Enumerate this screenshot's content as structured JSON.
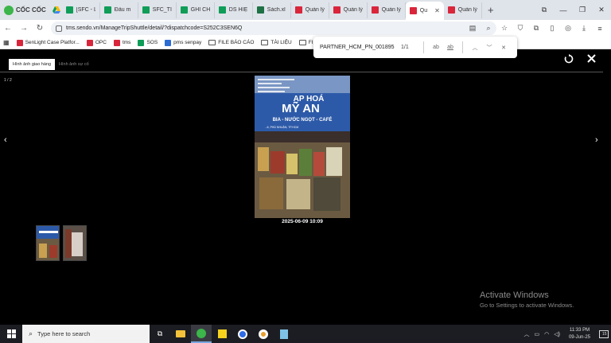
{
  "browser": {
    "brand": "CỐC CỐC",
    "tabs": [
      {
        "label": "[SFC - L",
        "color": "#0f9d58"
      },
      {
        "label": "Đầu m",
        "color": "#0f9d58"
      },
      {
        "label": "SFC_TI",
        "color": "#0f9d58"
      },
      {
        "label": "GHI CH",
        "color": "#0f9d58"
      },
      {
        "label": "DS HIỆ",
        "color": "#0f9d58"
      },
      {
        "label": "Sách.xl",
        "color": "#1e7145"
      },
      {
        "label": "Quản lý",
        "color": "#d9263b"
      },
      {
        "label": "Quản lý",
        "color": "#d9263b"
      },
      {
        "label": "Quản lý",
        "color": "#d9263b"
      },
      {
        "label": "Qu",
        "color": "#d9263b"
      },
      {
        "label": "Quản lý",
        "color": "#d9263b"
      }
    ],
    "url": "tms.sendo.vn/ManageTripShuttle/detail/?dispatchcode=S252C3SEN6Q",
    "bookmarks": [
      {
        "label": "SenLight Case Platfor...",
        "icon": "sendo-icon",
        "color": "#d9263b"
      },
      {
        "label": "OPC",
        "icon": "sendo-icon",
        "color": "#d9263b"
      },
      {
        "label": "tms",
        "icon": "sendo-icon",
        "color": "#d9263b"
      },
      {
        "label": "SOS",
        "icon": "sos-icon",
        "color": "#0f9d58"
      },
      {
        "label": "pms senpay",
        "icon": "senpay-icon",
        "color": "#2b6cd4"
      },
      {
        "label": "FILE BÁO CÁO",
        "icon": "folder-icon",
        "color": ""
      },
      {
        "label": "TÀI LIỆU",
        "icon": "folder-icon",
        "color": ""
      },
      {
        "label": "FILE C",
        "icon": "folder-icon",
        "color": ""
      }
    ]
  },
  "findbar": {
    "query": "PARTNER_HCM_PN_001895",
    "count": "1/1",
    "match_case_label": "ab",
    "whole_word_label": "ab"
  },
  "viewer": {
    "tabs": [
      {
        "label": "Hình ảnh giao hàng",
        "active": true
      },
      {
        "label": "Hình ảnh sự cố",
        "active": false
      }
    ],
    "counter": "1 / 2",
    "photo": {
      "timestamp": "2025-06-09 10:09",
      "store_sign_line1": "ẠP HOÁ",
      "store_sign_line2": "MỸ AN",
      "store_sign_line3": "BIA - NƯỚC NGỌT - CAFÉ",
      "store_address": "...6, PHÚ NHUẬN, TP.HCM"
    },
    "thumbnails": [
      {
        "selected": true
      },
      {
        "selected": false
      }
    ]
  },
  "watermark": {
    "title": "Activate Windows",
    "subtitle": "Go to Settings to activate Windows."
  },
  "taskbar": {
    "search_placeholder": "Type here to search",
    "time": "11:33 PM",
    "date": "09-Jun-25",
    "notifications": "15"
  }
}
